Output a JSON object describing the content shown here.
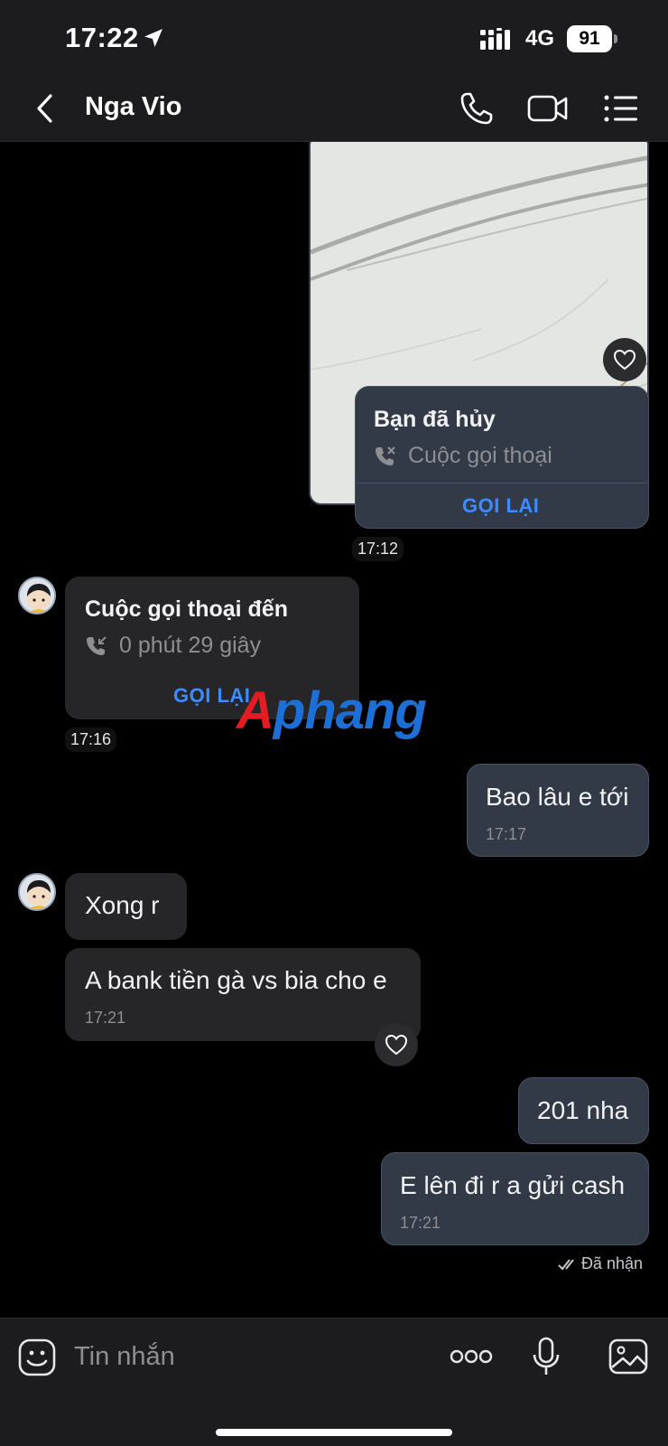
{
  "status_bar": {
    "time": "17:22",
    "network": "4G",
    "battery": "91"
  },
  "header": {
    "contact_name": "Nga Vio"
  },
  "messages": {
    "outgoing_call": {
      "title": "Bạn đã hủy",
      "subtitle": "Cuộc gọi thoại",
      "action": "GỌI LẠI",
      "time": "17:12"
    },
    "incoming_call": {
      "title": "Cuộc gọi thoại đến",
      "subtitle": "0 phút 29 giây",
      "action": "GỌI LẠI",
      "time": "17:16"
    },
    "out_1": {
      "text": "Bao lâu e tới",
      "time": "17:17"
    },
    "in_1": {
      "text": "Xong r"
    },
    "in_2": {
      "text": "A bank tiền gà vs bia cho e",
      "time": "17:21"
    },
    "out_2": {
      "text": "201 nha"
    },
    "out_3": {
      "text": "E lên đi r a gửi cash",
      "time": "17:21"
    },
    "delivery_status": "Đã nhận"
  },
  "watermark": {
    "first": "A",
    "rest": "phang"
  },
  "input": {
    "placeholder": "Tin nhắn"
  },
  "colors": {
    "accent": "#3d8bfd",
    "outgoing_bubble": "#323a48",
    "incoming_bubble": "#262628"
  }
}
